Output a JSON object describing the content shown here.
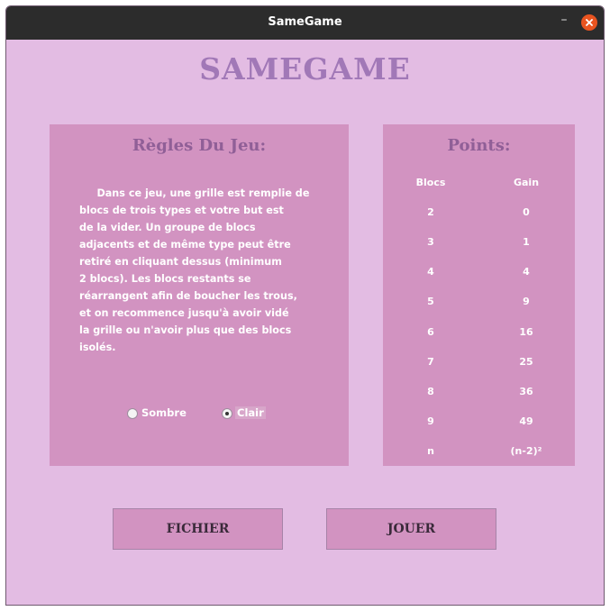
{
  "window": {
    "title": "SameGame",
    "minimize_glyph": "–"
  },
  "app_title": "SAMEGAME",
  "rules": {
    "heading": "Règles Du Jeu:",
    "lines": [
      "     Dans ce jeu, une grille est remplie de",
      "blocs de trois types et votre but est",
      "de la vider. Un groupe de blocs",
      "adjacents et de même type peut être",
      "retiré en cliquant dessus (minimum",
      "2 blocs). Les blocs restants se",
      "réarrangent afin de boucher les trous,",
      "et on recommence jusqu'à avoir vidé",
      "la grille ou n'avoir plus que des blocs",
      "isolés."
    ],
    "theme_options": [
      {
        "label": "Sombre",
        "selected": false
      },
      {
        "label": "Clair",
        "selected": true
      }
    ]
  },
  "points": {
    "heading": "Points:",
    "columns": [
      "Blocs",
      "Gain"
    ],
    "rows": [
      [
        "2",
        "0"
      ],
      [
        "3",
        "1"
      ],
      [
        "4",
        "4"
      ],
      [
        "5",
        "9"
      ],
      [
        "6",
        "16"
      ],
      [
        "7",
        "25"
      ],
      [
        "8",
        "36"
      ],
      [
        "9",
        "49"
      ],
      [
        "n",
        "(n-2)²"
      ]
    ]
  },
  "buttons": {
    "fichier": "FICHIER",
    "jouer": "JOUER"
  },
  "colors": {
    "background": "#e3bce3",
    "panel": "#d293c1",
    "title": "#a178b7",
    "heading": "#905f97",
    "titlebar": "#2c2c2c",
    "close_button": "#e95420"
  }
}
